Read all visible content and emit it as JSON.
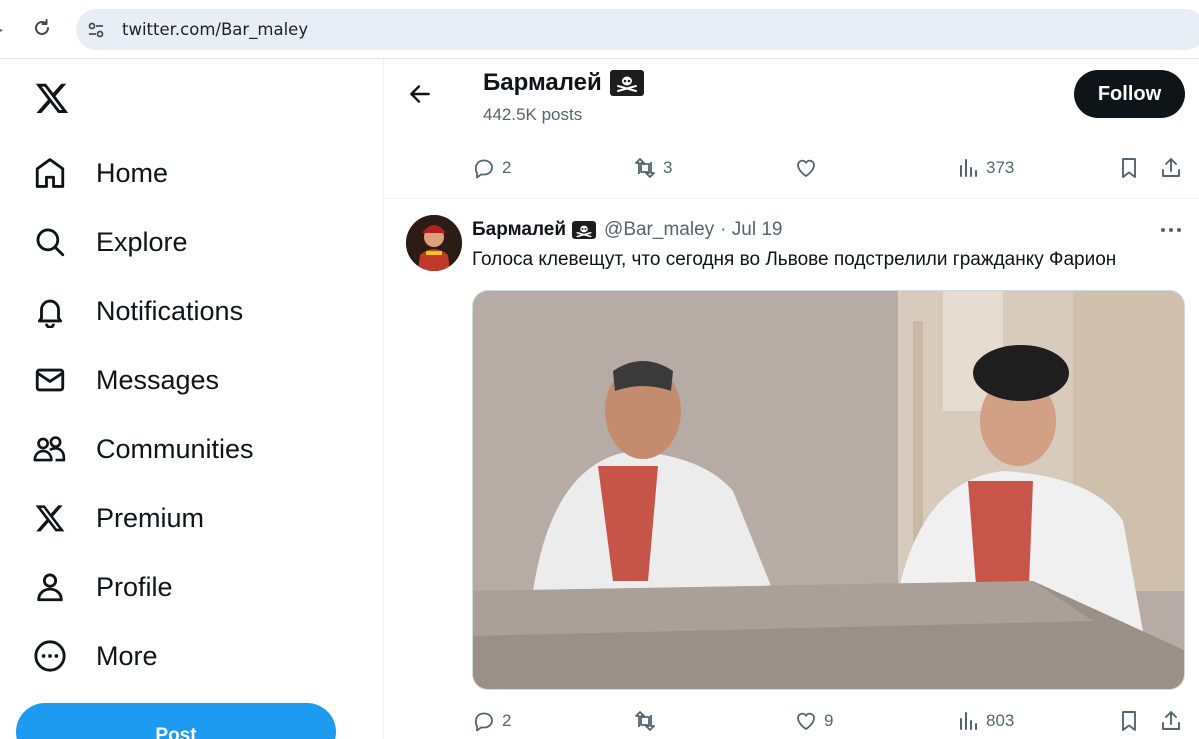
{
  "browser": {
    "url": "twitter.com/Bar_maley"
  },
  "sidebar": {
    "items": [
      {
        "label": "Home",
        "icon": "home-icon"
      },
      {
        "label": "Explore",
        "icon": "search-icon"
      },
      {
        "label": "Notifications",
        "icon": "bell-icon"
      },
      {
        "label": "Messages",
        "icon": "envelope-icon"
      },
      {
        "label": "Communities",
        "icon": "people-icon"
      },
      {
        "label": "Premium",
        "icon": "x-logo-icon"
      },
      {
        "label": "Profile",
        "icon": "person-icon"
      },
      {
        "label": "More",
        "icon": "more-circle-icon"
      }
    ],
    "post_label": "Post"
  },
  "header": {
    "name": "Бармалей",
    "posts": "442.5K posts",
    "follow_label": "Follow"
  },
  "prev_tweet": {
    "replies": "2",
    "retweets": "3",
    "likes": "",
    "views": "373"
  },
  "tweet": {
    "name": "Бармалей",
    "handle": "@Bar_maley",
    "date": "· Jul 19",
    "text": "Голоса клевещут, что сегодня во Львове подстрелили гражданку Фарион",
    "replies": "2",
    "retweets": "",
    "likes": "9",
    "views": "803"
  },
  "colors": {
    "accent": "#1d9bf0",
    "text": "#0f1419",
    "secondary": "#536471",
    "url_bar": "#e9eef6"
  }
}
